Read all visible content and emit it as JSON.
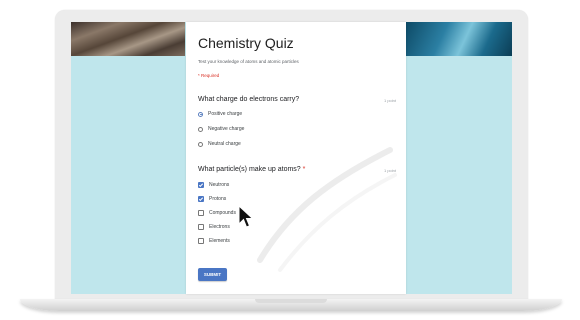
{
  "form": {
    "title": "Chemistry Quiz",
    "description": "Test your knowledge of atoms and atomic particles",
    "required_note": "* Required",
    "questions": [
      {
        "title": "What charge do electrons carry?",
        "required_mark": "",
        "points": "1 point",
        "type": "radio",
        "options": [
          {
            "label": "Positive charge",
            "selected": true
          },
          {
            "label": "Negative charge",
            "selected": false
          },
          {
            "label": "Neutral charge",
            "selected": false
          }
        ]
      },
      {
        "title": "What particle(s) make up atoms?",
        "required_mark": "*",
        "points": "1 point",
        "type": "checkbox",
        "options": [
          {
            "label": "Neutrons",
            "selected": true
          },
          {
            "label": "Protons",
            "selected": true
          },
          {
            "label": "Compounds",
            "selected": false
          },
          {
            "label": "Electrons",
            "selected": false
          },
          {
            "label": "Elements",
            "selected": false
          }
        ]
      }
    ],
    "submit_label": "SUBMIT"
  },
  "colors": {
    "background": "#bfe6ec",
    "accent": "#4a76c4",
    "required": "#d93025"
  },
  "icons": {
    "cursor": "mouse-pointer-icon"
  }
}
